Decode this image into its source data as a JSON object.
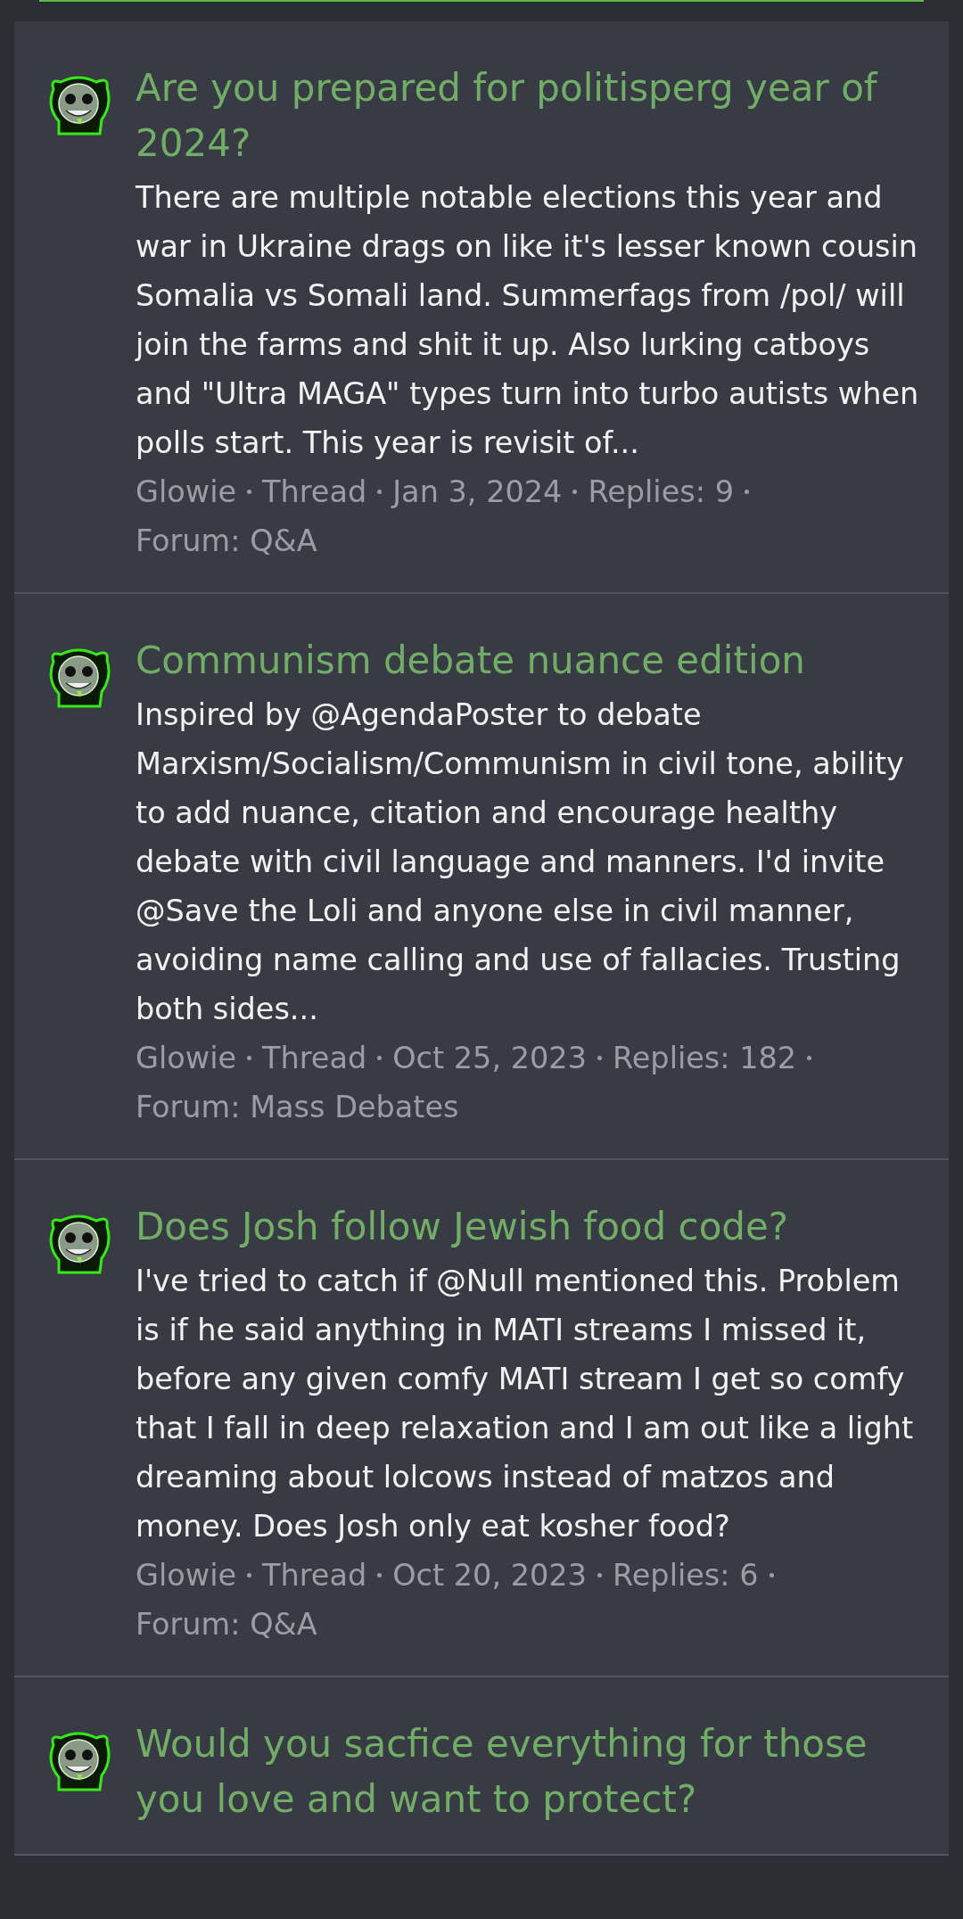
{
  "threads": [
    {
      "title": "Are you prepared for politisperg year of 2024?",
      "snippet": "There are multiple notable elections this year and war in Ukraine drags on like it's lesser known cousin Somalia vs Somali land. Summerfags from /pol/ will join the farms and shit it up. Also lurking catboys and \"Ultra MAGA\" types turn into turbo autists when polls start. This year is revisit of...",
      "meta": [
        "Glowie",
        "Thread",
        "Jan 3, 2024",
        "Replies: 9",
        "Forum: Q&A"
      ]
    },
    {
      "title": "Communism debate nuance edition",
      "snippet": "Inspired by @AgendaPoster to debate Marxism/Socialism/Communism in civil tone, ability to add nuance, citation and encourage healthy debate with civil language and manners. I'd invite @Save the Loli and anyone else in civil manner, avoiding name calling and use of fallacies. Trusting both sides...",
      "meta": [
        "Glowie",
        "Thread",
        "Oct 25, 2023",
        "Replies: 182",
        "Forum: Mass Debates"
      ]
    },
    {
      "title": "Does Josh follow Jewish food code?",
      "snippet": "I've tried to catch if @Null mentioned this. Problem is if he said anything in MATI streams I missed it, before any given comfy MATI stream I get so comfy that I fall in deep relaxation and I am out like a light dreaming about lolcows instead of matzos and money. Does Josh only eat kosher food?",
      "meta": [
        "Glowie",
        "Thread",
        "Oct 20, 2023",
        "Replies: 6",
        "Forum: Q&A"
      ]
    },
    {
      "title": "Would you sacfice everything for those you love and want to protect?"
    }
  ]
}
